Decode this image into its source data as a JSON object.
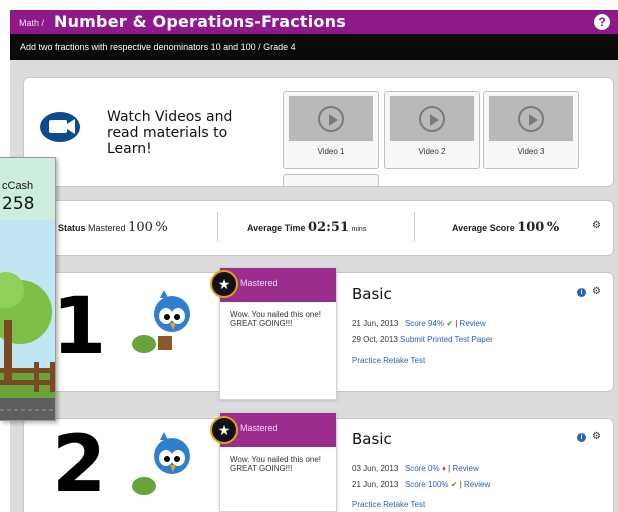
{
  "header": {
    "breadcrumb": "Math /",
    "title": "Number & Operations-Fractions",
    "help": "?",
    "subtitle": "Add two fractions with respective denominators 10 and 100 / Grade 4"
  },
  "videos": {
    "prompt_lines": [
      "Watch Videos and",
      "read materials to",
      "Learn!"
    ],
    "items": [
      "Video 1",
      "Video 2",
      "Video 3"
    ]
  },
  "stats": {
    "status_label": "Status",
    "status_value": "Mastered",
    "status_percent": "100",
    "status_unit": "%",
    "time_label": "Average Time",
    "time_value": "02:51",
    "time_unit": "mins",
    "score_label": "Average Score",
    "score_value": "100",
    "score_unit": "%"
  },
  "levels": [
    {
      "number": "1",
      "badge": "Mastered",
      "message": "Wow. You nailed this one! GREAT GOING!!!",
      "name": "Basic",
      "lines": [
        {
          "date": "21 Jun, 2013",
          "score": "Score 94%",
          "review": "Review"
        },
        {
          "date": "29 Oct, 2013",
          "action": "Submit Printed Test Paper"
        }
      ],
      "practice": "Practice Retake Test"
    },
    {
      "number": "2",
      "badge": "Mastered",
      "message": "Wow. You nailed this one! GREAT GOING!!!",
      "name": "Basic",
      "lines": [
        {
          "date": "03 Jun, 2013",
          "score": "Score 0%",
          "review": "Review"
        },
        {
          "date": "21 Jun, 2013",
          "score": "Score 100%",
          "review": "Review"
        }
      ],
      "practice": "Practice Retake Test"
    }
  ],
  "side": {
    "cash_label": "cCash",
    "cash_value": "258"
  },
  "colors": {
    "header": "#8e1a8a",
    "link": "#2a62b8",
    "badge": "#9b2d8f"
  }
}
